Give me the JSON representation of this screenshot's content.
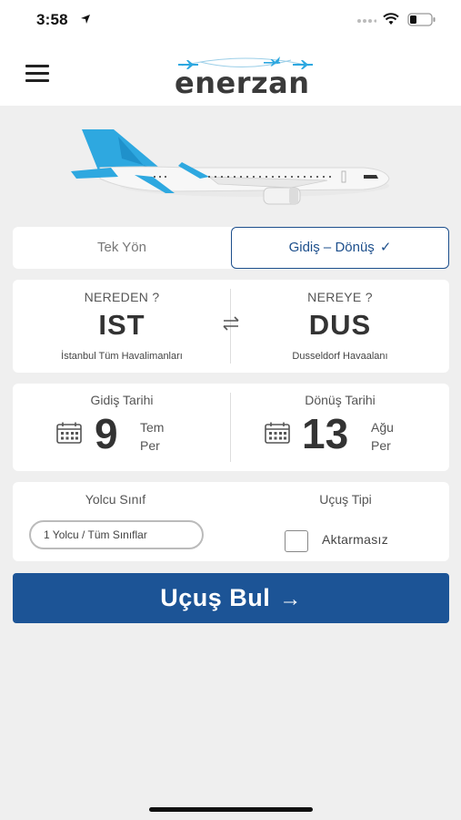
{
  "status_bar": {
    "time": "3:58"
  },
  "header": {
    "logo_text": "enerzan"
  },
  "trip_type": {
    "one_way": "Tek Yön",
    "round_trip": "Gidiş – Dönüş",
    "check": "✓"
  },
  "route": {
    "from": {
      "label": "NEREDEN ?",
      "code": "IST",
      "name": "İstanbul Tüm Havalimanları"
    },
    "to": {
      "label": "NEREYE ?",
      "code": "DUS",
      "name": "Dusseldorf Havaalanı"
    },
    "swap_glyph": "⇆"
  },
  "dates": {
    "departure": {
      "label": "Gidiş Tarihi",
      "day": "9",
      "month": "Tem",
      "weekday": "Per"
    },
    "return": {
      "label": "Dönüş Tarihi",
      "day": "13",
      "month": "Ağu",
      "weekday": "Per"
    }
  },
  "passengers": {
    "label": "Yolcu Sınıf",
    "value": "1 Yolcu / Tüm Sınıflar"
  },
  "flight_type": {
    "label": "Uçuş Tipi",
    "option": "Aktarmasız",
    "checked": false
  },
  "search": {
    "label": "Uçuş Bul",
    "arrow": "→"
  },
  "colors": {
    "primary": "#1c5496",
    "accent": "#2ea8e0"
  }
}
